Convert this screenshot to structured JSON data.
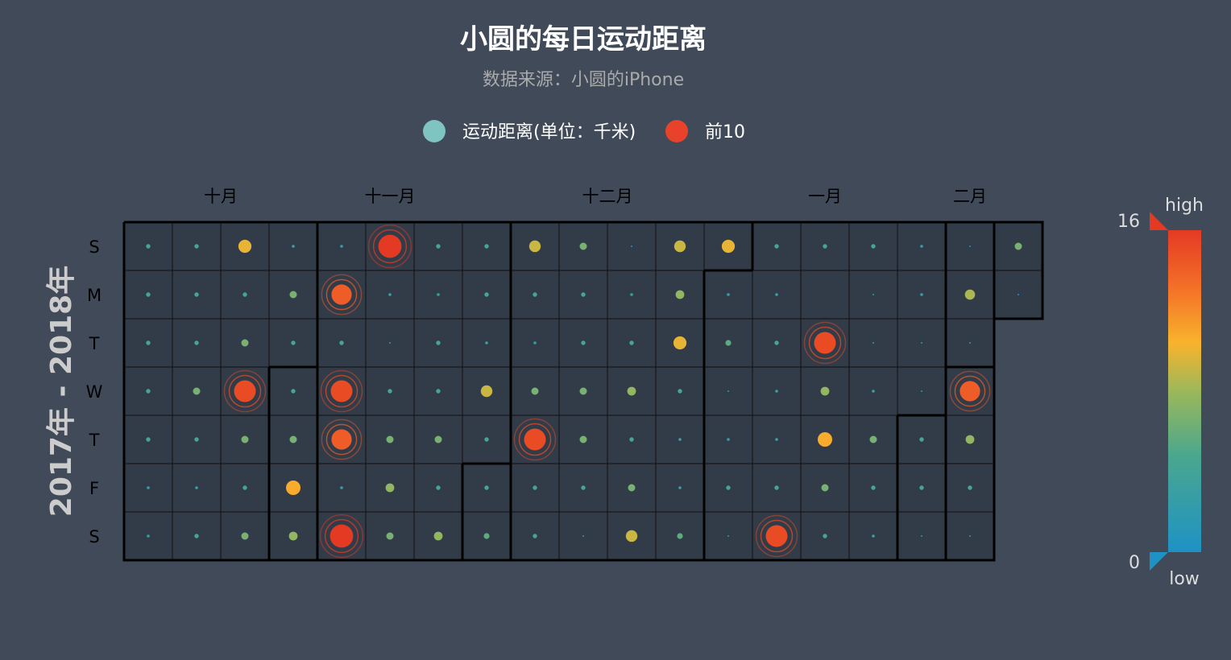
{
  "chart_data": {
    "type": "heatmap",
    "title": "小圆的每日运动距离",
    "subtitle": "数据来源：小圆的iPhone",
    "legend": [
      {
        "name": "运动距离(单位：千米)",
        "color": "#7fc4c0"
      },
      {
        "name": "前10",
        "color": "#e8432a"
      }
    ],
    "year_label": "2017年 - 2018年",
    "day_labels": [
      "S",
      "M",
      "T",
      "W",
      "T",
      "F",
      "S"
    ],
    "month_labels": [
      {
        "label": "十月",
        "week": 2
      },
      {
        "label": "十一月",
        "week": 5.5
      },
      {
        "label": "十二月",
        "week": 10
      },
      {
        "label": "一月",
        "week": 14.5
      },
      {
        "label": "二月",
        "week": 17.5
      }
    ],
    "visual_map": {
      "min": 0,
      "max": 16,
      "high_text": "high",
      "low_text": "low",
      "colors": [
        "#1e92c5",
        "#4aa78e",
        "#9cb85a",
        "#f8b32c",
        "#f47028",
        "#e43a24"
      ]
    },
    "weeks": [
      [
        3,
        3,
        3,
        3,
        3,
        2,
        2
      ],
      [
        3,
        3,
        3,
        5,
        3,
        2,
        3
      ],
      [
        9,
        3,
        5,
        15,
        5,
        3,
        5
      ],
      [
        2,
        5,
        3,
        3,
        5,
        10,
        6
      ],
      [
        2,
        14,
        3,
        15,
        14,
        2,
        16
      ],
      [
        16,
        2,
        1,
        3,
        5,
        6,
        5
      ],
      [
        3,
        2,
        3,
        3,
        5,
        3,
        6
      ],
      [
        3,
        3,
        2,
        8,
        3,
        3,
        4
      ],
      [
        8,
        3,
        2,
        5,
        15,
        3,
        3
      ],
      [
        5,
        3,
        3,
        5,
        5,
        3,
        1
      ],
      [
        0,
        2,
        3,
        6,
        3,
        5,
        8
      ],
      [
        8,
        6,
        9,
        3,
        2,
        2,
        4
      ],
      [
        9,
        2,
        4,
        1,
        2,
        3,
        1
      ],
      [
        3,
        2,
        3,
        2,
        2,
        3,
        15
      ],
      [
        3,
        null,
        15,
        6,
        10,
        5,
        3
      ],
      [
        3,
        1,
        1,
        2,
        5,
        3,
        2
      ],
      [
        2,
        2,
        1,
        1,
        3,
        3,
        1
      ],
      [
        0,
        7,
        1,
        14,
        6,
        3,
        1
      ],
      [
        5,
        0,
        null,
        null,
        null,
        null,
        null
      ]
    ],
    "top10_threshold": 14
  }
}
